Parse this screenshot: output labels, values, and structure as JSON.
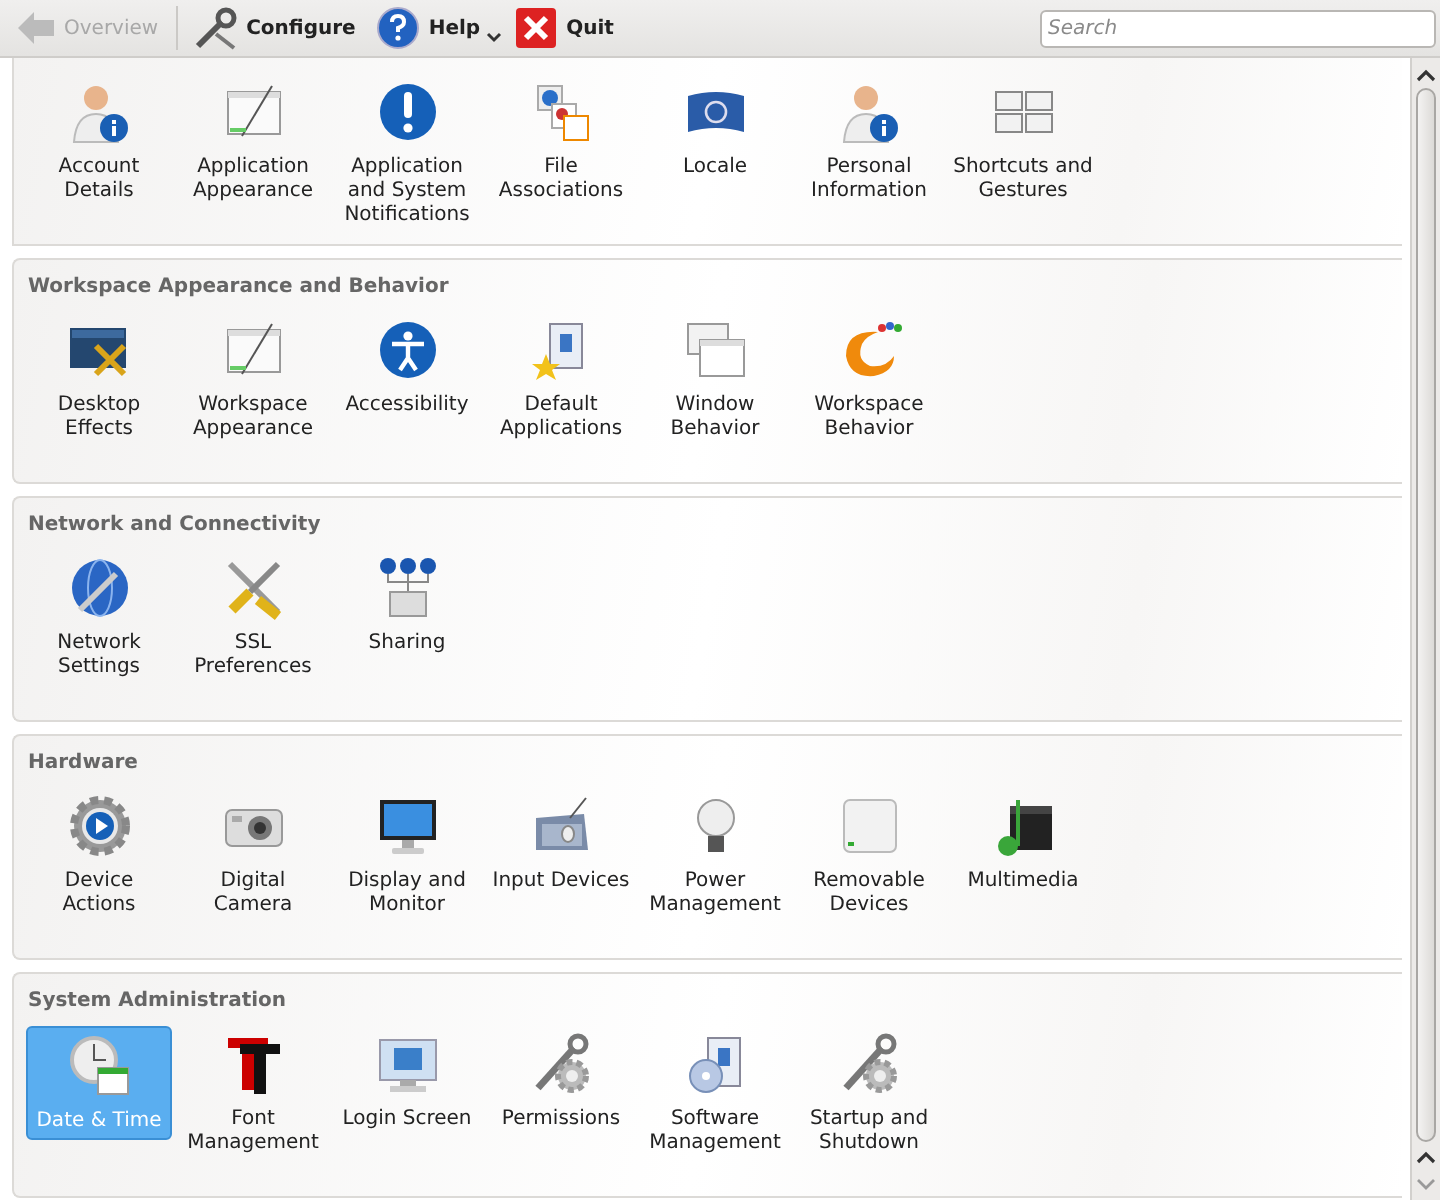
{
  "toolbar": {
    "buttons": [
      {
        "kind": "back",
        "label": "Overview",
        "disabled": true
      },
      {
        "kind": "configure",
        "label": "Configure",
        "disabled": false
      },
      {
        "kind": "help",
        "label": "Help",
        "disabled": false,
        "dropdown": true
      },
      {
        "kind": "quit",
        "label": "Quit",
        "disabled": false
      }
    ],
    "search": {
      "placeholder": "Search"
    }
  },
  "sections": [
    {
      "items": [
        {
          "label": "Account Details",
          "selected": false
        },
        {
          "label": "Application Appearance",
          "selected": false
        },
        {
          "label": "Application and System Notifications",
          "selected": false
        },
        {
          "label": "File Associations",
          "selected": false
        },
        {
          "label": "Locale",
          "selected": false
        },
        {
          "label": "Personal Information",
          "selected": false
        },
        {
          "label": "Shortcuts and Gestures",
          "selected": false
        }
      ]
    },
    {
      "title": "Workspace Appearance and Behavior",
      "items": [
        {
          "label": "Desktop Effects",
          "selected": false
        },
        {
          "label": "Workspace Appearance",
          "selected": false
        },
        {
          "label": "Accessibility",
          "selected": false
        },
        {
          "label": "Default Applications",
          "selected": false
        },
        {
          "label": "Window Behavior",
          "selected": false
        },
        {
          "label": "Workspace Behavior",
          "selected": false
        }
      ]
    },
    {
      "title": "Network and Connectivity",
      "items": [
        {
          "label": "Network Settings",
          "selected": false
        },
        {
          "label": "SSL Preferences",
          "selected": false
        },
        {
          "label": "Sharing",
          "selected": false
        }
      ]
    },
    {
      "title": "Hardware",
      "items": [
        {
          "label": "Device Actions",
          "selected": false
        },
        {
          "label": "Digital Camera",
          "selected": false
        },
        {
          "label": "Display and Monitor",
          "selected": false
        },
        {
          "label": "Input Devices",
          "selected": false
        },
        {
          "label": "Power Management",
          "selected": false
        },
        {
          "label": "Removable Devices",
          "selected": false
        },
        {
          "label": "Multimedia",
          "selected": false
        }
      ]
    },
    {
      "title": "System Administration",
      "items": [
        {
          "label": "Date & Time",
          "selected": true
        },
        {
          "label": "Font Management",
          "selected": false
        },
        {
          "label": "Login Screen",
          "selected": false
        },
        {
          "label": "Permissions",
          "selected": false
        },
        {
          "label": "Software Management",
          "selected": false
        },
        {
          "label": "Startup and Shutdown",
          "selected": false
        }
      ]
    }
  ]
}
